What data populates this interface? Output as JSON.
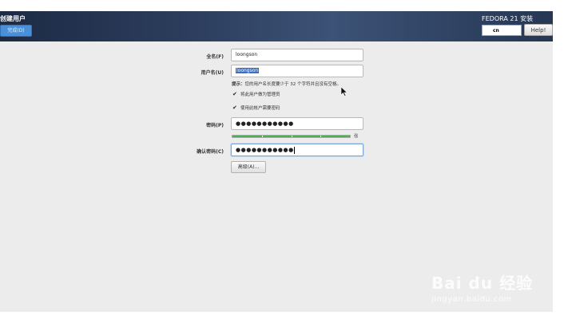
{
  "header": {
    "title": "创建用户",
    "done_label": "完成(D)",
    "product": "FEDORA 21 安装",
    "lang_value": "cn",
    "help_label": "Help!"
  },
  "form": {
    "fullname_label": "全名(F)",
    "fullname_value": "loongson",
    "username_label": "用户名(U)",
    "username_value": "loongson",
    "hint_prefix": "提示：",
    "hint_text": "您的用户名长度要少于 32 个字符并且没有空格。",
    "admin_label": "将此用户做为管理员",
    "require_pw_label": "使用此帐户需要密码",
    "password_label": "密码(P)",
    "password_value": "●●●●●●●●●●●",
    "strength": 1.0,
    "strength_end": "强",
    "confirm_label": "确认密码(C)",
    "confirm_value": "●●●●●●●●●●●",
    "advanced_label": "高级(A)..."
  },
  "watermark": {
    "logo": "Bai du 经验",
    "url": "jingyan.baidu.com"
  },
  "colors": {
    "header_bg": "#2d3e5e",
    "done_btn": "#4a90d9",
    "selection": "#3d6fc0",
    "strength_fill": "#4caf50"
  }
}
